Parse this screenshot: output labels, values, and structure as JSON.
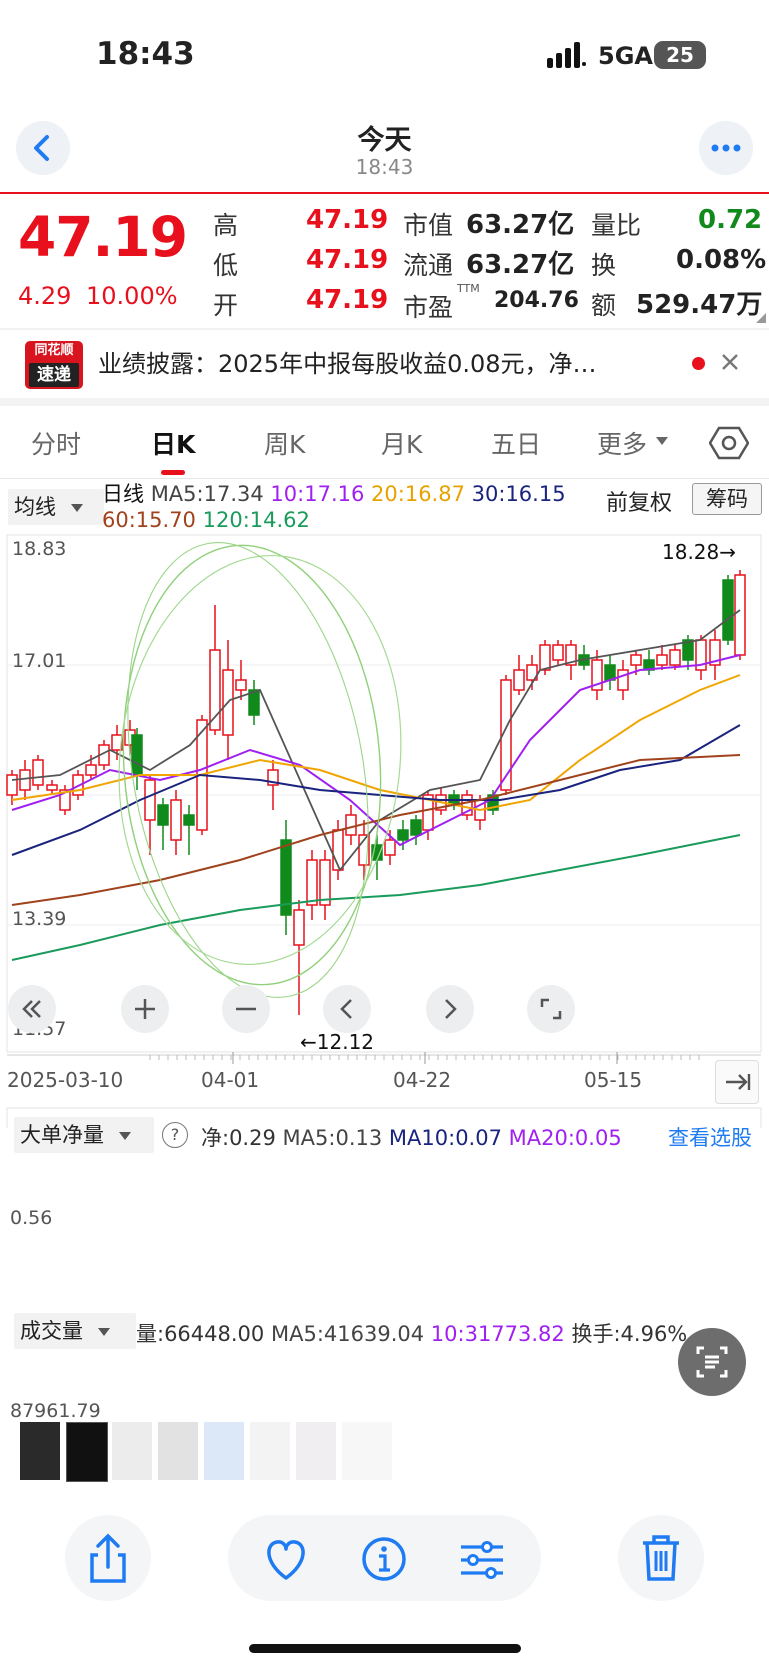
{
  "status": {
    "time": "18:43",
    "network": "5GA",
    "battery": "25"
  },
  "nav": {
    "title": "今天",
    "subtitle": "18:43"
  },
  "quote": {
    "price": "47.19",
    "change": "4.29",
    "change_pct": "10.00%",
    "high_label": "高",
    "high": "47.19",
    "low_label": "低",
    "low": "47.19",
    "open_label": "开",
    "open": "47.19",
    "mktcap_label": "市值",
    "mktcap": "63.27亿",
    "float_label": "流通",
    "float": "63.27亿",
    "pe_label": "市盈",
    "pe_sup": "TTM",
    "pe": "204.76",
    "volratio_label": "量比",
    "volratio": "0.72",
    "turnover_label": "换",
    "turnover": "0.08%",
    "amount_label": "额",
    "amount": "529.47万"
  },
  "banner": {
    "logo_top": "同花顺",
    "logo_bottom": "速递",
    "text": "业绩披露：2025年中报每股收益0.08元，净…"
  },
  "tabs": [
    "分时",
    "日K",
    "周K",
    "月K",
    "五日",
    "更多"
  ],
  "active_tab": "日K",
  "kline": {
    "indicator_select": "均线",
    "period": "日线",
    "ma5": "MA5:17.34",
    "ma10": "10:17.16",
    "ma20": "20:16.87",
    "ma30": "30:16.15",
    "ma60": "60:15.70",
    "ma120": "120:14.62",
    "adjust": "前复权",
    "chips_btn": "筹码",
    "y_labels": [
      "18.83",
      "17.01",
      "13.39",
      "11.57"
    ],
    "max_label": "18.28→",
    "min_label": "←12.12",
    "dates": [
      "2025-03-10",
      "04-01",
      "04-22",
      "05-15"
    ],
    "colors": {
      "ma5": "#555555",
      "ma10": "#a020f0",
      "ma20": "#f0a500",
      "ma30": "#1a237e",
      "ma60": "#a0421c",
      "ma120": "#1a9b5c",
      "up": "#e8101c",
      "down": "#118a1c"
    }
  },
  "bigorder": {
    "select": "大单净量",
    "help": "?",
    "net": "净:0.29",
    "ma5": "MA5:0.13",
    "ma10": "MA10:0.07",
    "ma20": "MA20:0.05",
    "link": "查看选股",
    "y_label": "0.56"
  },
  "volume": {
    "select": "成交量",
    "vol": "量:66448.00",
    "ma5": "MA5:41639.04",
    "ma10": "10:31773.82",
    "turn": "换手:4.96%",
    "y_label": "87961.79"
  },
  "toolbar": {
    "icons": [
      "share-icon",
      "heart-icon",
      "info-icon",
      "adjust-icon",
      "trash-icon"
    ]
  }
}
